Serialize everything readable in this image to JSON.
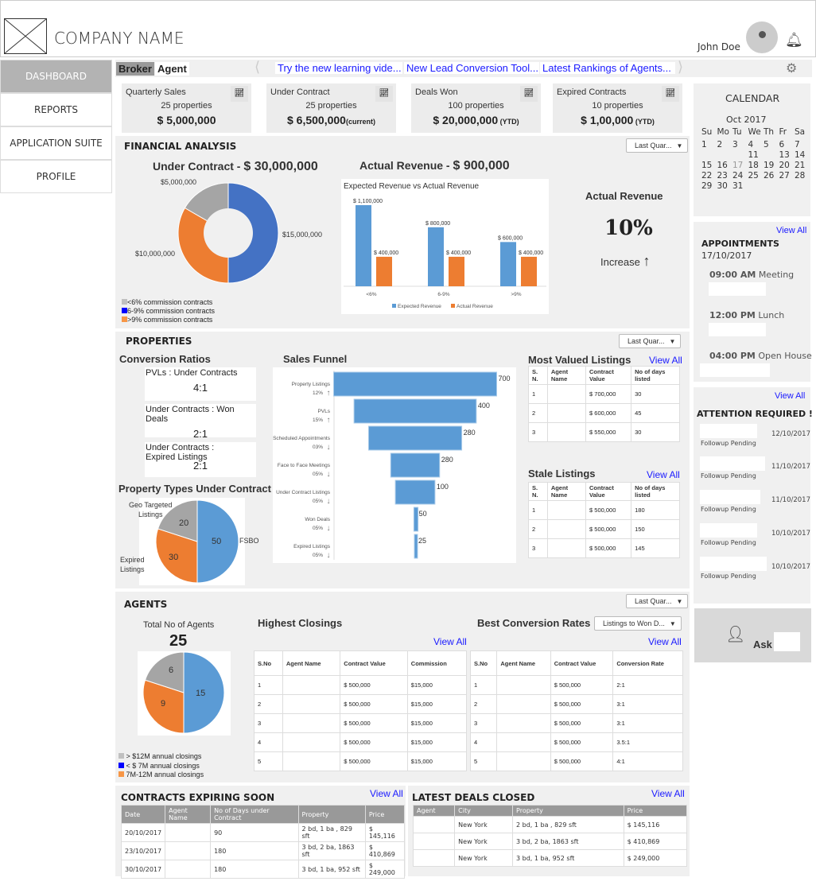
{
  "header": {
    "company": "COMPANY NAME",
    "user": "John Doe"
  },
  "sidebar": {
    "items": [
      {
        "label": "DASHBOARD",
        "active": true
      },
      {
        "label": "REPORTS"
      },
      {
        "label": "APPLICATION SUITE"
      },
      {
        "label": "PROFILE"
      }
    ]
  },
  "tabs": {
    "broker": "Broker",
    "agent": "Agent"
  },
  "ticker": [
    "Try the new learning vide...",
    "New Lead Conversion Tool...",
    "Latest Rankings of Agents..."
  ],
  "kpis": [
    {
      "title": "Quarterly Sales",
      "props": "25 properties",
      "value": "$ 5,000,000",
      "suffix": ""
    },
    {
      "title": "Under Contract",
      "props": "25 properties",
      "value": "$ 6,500,000",
      "suffix": "(current)"
    },
    {
      "title": "Deals Won",
      "props": "100 properties",
      "value": "$ 20,000,000",
      "suffix": " (YTD)"
    },
    {
      "title": "Expired Contracts",
      "props": "10 properties",
      "value": "$ 1,00,000",
      "suffix": " (YTD)"
    }
  ],
  "filter": "Last Quar...",
  "financial": {
    "title": "FINANCIAL ANALYSIS",
    "under_contract_label": "Under Contract - ",
    "under_contract_value": "$ 30,000,000",
    "actual_revenue_label": "Actual Revenue - ",
    "actual_revenue_value": "$ 900,000",
    "kpi_title": "Actual Revenue",
    "kpi_value": "10%",
    "kpi_trend": "Increase",
    "legend": [
      "<6% commission contracts",
      "6-9% commission contracts",
      ">9% commission contracts"
    ]
  },
  "properties": {
    "title": "PROPERTIES",
    "conv_title": "Conversion Ratios",
    "ratios": [
      {
        "label": "PVLs : Under Contracts",
        "value": "4:1"
      },
      {
        "label": "Under Contracts : Won Deals",
        "value": "2:1"
      },
      {
        "label": "Under Contracts : Expired Listings",
        "value": "2:1"
      }
    ],
    "types_title": "Property Types Under Contract",
    "funnel_title": "Sales Funnel",
    "mvl_title": "Most Valued Listings",
    "stale_title": "Stale Listings",
    "view_all": "View All",
    "listing_headers": [
      "S. N.",
      "Agent Name",
      "Contract Value",
      "No of days listed"
    ],
    "mvl_rows": [
      [
        "1",
        "",
        "$ 700,000",
        "30"
      ],
      [
        "2",
        "",
        "$ 600,000",
        "45"
      ],
      [
        "3",
        "",
        "$ 550,000",
        "30"
      ]
    ],
    "stale_rows": [
      [
        "1",
        "",
        "$ 500,000",
        "180"
      ],
      [
        "2",
        "",
        "$ 500,000",
        "150"
      ],
      [
        "3",
        "",
        "$ 500,000",
        "145"
      ]
    ]
  },
  "agents": {
    "title": "AGENTS",
    "total_label": "Total No of Agents",
    "total": "25",
    "legend": [
      "> $12M annual closings",
      "< $ 7M annual closings",
      "7M-12M annual closings"
    ],
    "hc_title": "Highest Closings",
    "bc_title": "Best Conversion Rates",
    "bc_filter": "Listings to Won D...",
    "hc_headers": [
      "S.No",
      "Agent Name",
      "Contract Value",
      "Commission"
    ],
    "hc_rows": [
      [
        "1",
        "",
        "$ 500,000",
        "$15,000"
      ],
      [
        "2",
        "",
        "$ 500,000",
        "$15,000"
      ],
      [
        "3",
        "",
        "$ 500,000",
        "$15,000"
      ],
      [
        "4",
        "",
        "$ 500,000",
        "$15,000"
      ],
      [
        "5",
        "",
        "$ 500,000",
        "$15,000"
      ]
    ],
    "bc_headers": [
      "S.No",
      "Agent Name",
      "Contract Value",
      "Conversion Rate"
    ],
    "bc_rows": [
      [
        "1",
        "",
        "$ 500,000",
        "2:1"
      ],
      [
        "2",
        "",
        "$ 500,000",
        "3:1"
      ],
      [
        "3",
        "",
        "$ 500,000",
        "3:1"
      ],
      [
        "4",
        "",
        "$ 500,000",
        "3.5:1"
      ],
      [
        "5",
        "",
        "$ 500,000",
        "4:1"
      ]
    ]
  },
  "expiring": {
    "title": "CONTRACTS EXPIRING SOON",
    "headers": [
      "Date",
      "Agent Name",
      "No of Days under Contract",
      "Property",
      "Price"
    ],
    "rows": [
      [
        "20/10/2017",
        "",
        "90",
        "2 bd, 1 ba , 829 sft",
        "$ 145,116"
      ],
      [
        "23/10/2017",
        "",
        "180",
        "3 bd, 2 ba, 1863 sft",
        "$ 410,869"
      ],
      [
        "30/10/2017",
        "",
        "180",
        "3 bd, 1 ba, 952 sft",
        "$ 249,000"
      ]
    ]
  },
  "deals": {
    "title": "LATEST DEALS CLOSED",
    "headers": [
      "Agent",
      "City",
      "Property",
      "Price"
    ],
    "rows": [
      [
        "",
        "New York",
        "2 bd, 1 ba , 829 sft",
        "$ 145,116"
      ],
      [
        "",
        "New York",
        "3 bd, 2 ba, 1863 sft",
        "$ 410,869"
      ],
      [
        "",
        "New York",
        "3 bd, 1 ba, 952 sft",
        "$ 249,000"
      ]
    ]
  },
  "calendar": {
    "title": "CALENDAR",
    "month": "Oct  2017",
    "days": [
      "Su",
      "Mo",
      "Tu",
      "We",
      "Th",
      "Fr",
      "Sa"
    ],
    "weeks": [
      [
        "1",
        "2",
        "3",
        "4",
        "5",
        "6",
        "7"
      ],
      [
        "",
        "",
        "",
        "11",
        "",
        "13",
        "14"
      ],
      [
        "15",
        "16",
        "17",
        "18",
        "19",
        "20",
        "21"
      ],
      [
        "22",
        "23",
        "24",
        "25",
        "26",
        "27",
        "28"
      ],
      [
        "29",
        "30",
        "31",
        "",
        "",
        "",
        ""
      ]
    ],
    "today": "17"
  },
  "appointments": {
    "title": "APPOINTMENTS",
    "date": "17/10/2017",
    "items": [
      {
        "time": "09:00 AM",
        "label": "Meeting"
      },
      {
        "time": "12:00 PM",
        "label": "Lunch"
      },
      {
        "time": "04:00 PM",
        "label": "Open House"
      }
    ]
  },
  "attention": {
    "title": "ATTENTION REQUIRED !",
    "items": [
      {
        "status": "Followup Pending",
        "date": "12/10/2017"
      },
      {
        "status": "Followup Pending",
        "date": "11/10/2017"
      },
      {
        "status": "Followup Pending",
        "date": "11/10/2017"
      },
      {
        "status": "Followup Pending",
        "date": "10/10/2017"
      },
      {
        "status": "Followup Pending",
        "date": "10/10/2017"
      }
    ]
  },
  "ask": {
    "label": "Ask"
  },
  "chart_data": [
    {
      "type": "pie",
      "title": "Under Contract",
      "donut": true,
      "labels": [
        "<6%",
        "6-9%",
        ">9%"
      ],
      "values": [
        5000000,
        15000000,
        10000000
      ],
      "value_labels": [
        "$5,000,000",
        "$15,000,000",
        "$10,000,000"
      ],
      "colors": [
        "#a5a5a5",
        "#4472c4",
        "#ed7d31"
      ]
    },
    {
      "type": "bar",
      "title": "Expected Revenue vs Actual Revenue",
      "categories": [
        "<6%",
        "6-9%",
        ">9%"
      ],
      "series": [
        {
          "name": "Expected Revenue",
          "values": [
            1100000,
            800000,
            600000
          ],
          "labels": [
            "$ 1,100,000",
            "$ 800,000",
            "$ 600,000"
          ],
          "color": "#5b9bd5"
        },
        {
          "name": "Actual Revenue",
          "values": [
            400000,
            400000,
            400000
          ],
          "labels": [
            "$ 400,000",
            "$ 400,000",
            "$ 400,000"
          ],
          "color": "#ed7d31"
        }
      ],
      "ylim": [
        0,
        1200000
      ]
    },
    {
      "type": "bar",
      "title": "Sales Funnel",
      "orientation": "funnel",
      "categories": [
        "Property Listings",
        "PVLs",
        "Scheduled Appointments",
        "Face to Face Meetings",
        "Under Contract Listings",
        "Won  Deals",
        "Expired Listings"
      ],
      "values": [
        700,
        400,
        280,
        280,
        100,
        50,
        25
      ],
      "changes": [
        "12%",
        "15%",
        "03%",
        "05%",
        "05%",
        "05%",
        "05%"
      ],
      "trends": [
        "up",
        "up",
        "down",
        "down",
        "down",
        "down",
        "down"
      ],
      "widths": [
        700,
        525,
        400,
        210,
        170,
        18,
        6
      ]
    },
    {
      "type": "pie",
      "title": "Property Types Under Contract",
      "labels": [
        "FSBO",
        "Expired Listings",
        "Geo Targeted Listings"
      ],
      "values": [
        50,
        30,
        20
      ],
      "colors": [
        "#5b9bd5",
        "#ed7d31",
        "#a5a5a5"
      ]
    },
    {
      "type": "pie",
      "title": "Total No of Agents",
      "labels": [
        "< $ 7M annual closings",
        "7M-12M annual closings",
        "> $12M annual closings"
      ],
      "values": [
        15,
        9,
        6
      ],
      "colors": [
        "#5b9bd5",
        "#ed7d31",
        "#a5a5a5"
      ]
    }
  ]
}
